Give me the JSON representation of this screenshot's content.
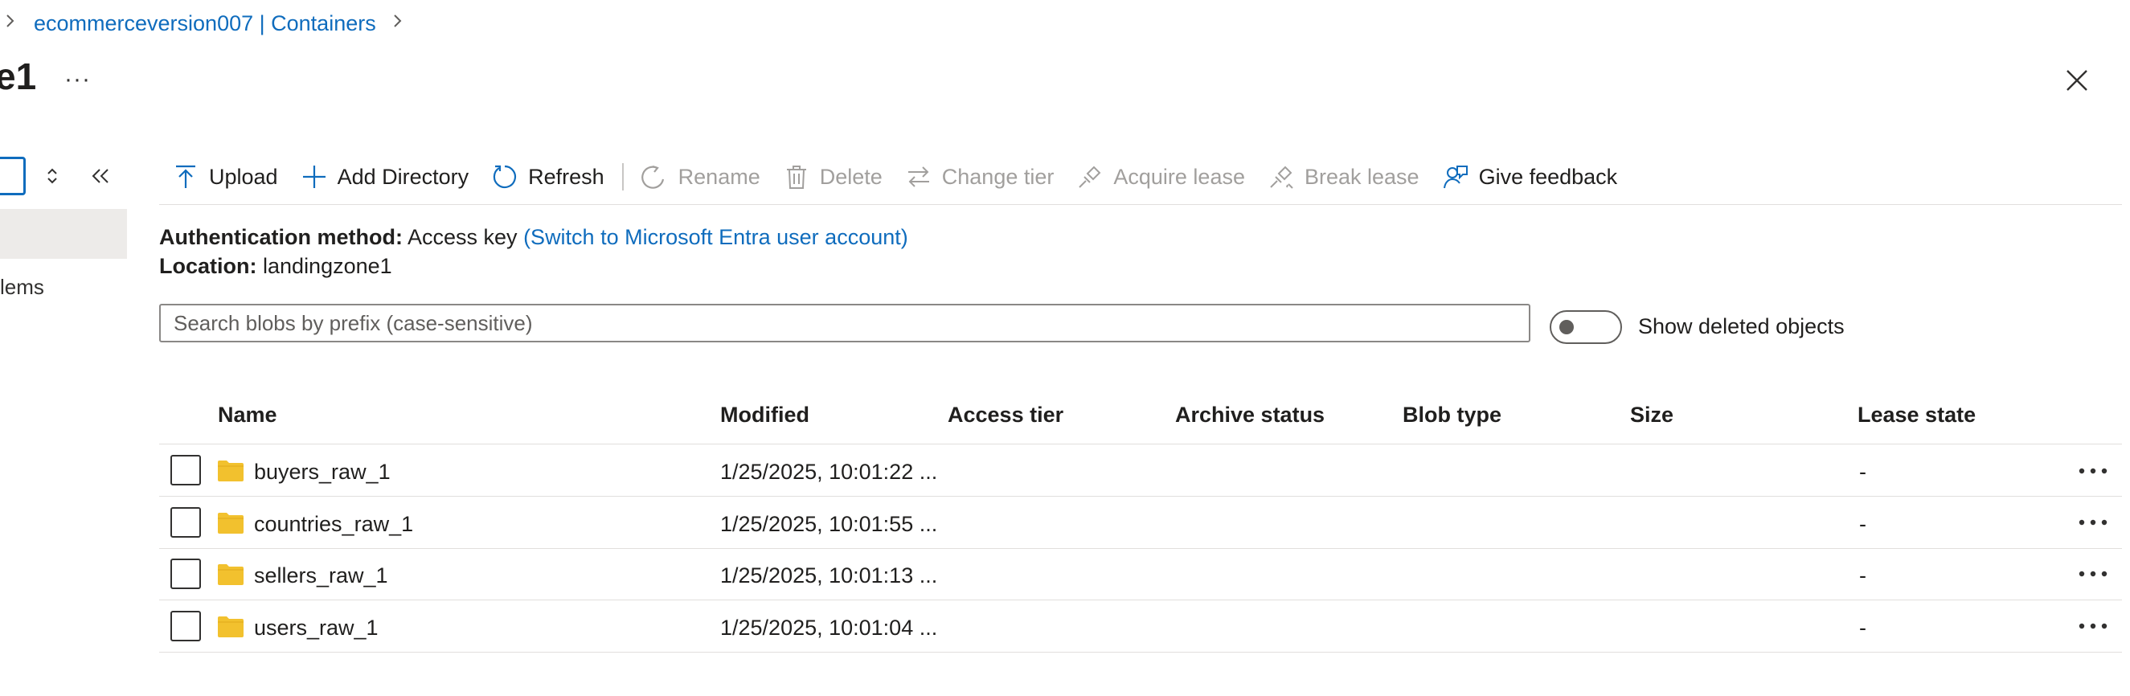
{
  "breadcrumb": {
    "link": "ecommerceversion007 | Containers"
  },
  "page": {
    "title": "e1",
    "more": "···"
  },
  "left_panel": {
    "item": "lems"
  },
  "toolbar": {
    "buttons": [
      {
        "label": "Upload",
        "icon": "upload-icon",
        "enabled": true
      },
      {
        "label": "Add Directory",
        "icon": "add-icon",
        "enabled": true
      },
      {
        "label": "Refresh",
        "icon": "refresh-icon",
        "enabled": true
      },
      {
        "label": "Rename",
        "icon": "rename-icon",
        "enabled": false
      },
      {
        "label": "Delete",
        "icon": "trash-icon",
        "enabled": false
      },
      {
        "label": "Change tier",
        "icon": "swap-icon",
        "enabled": false
      },
      {
        "label": "Acquire lease",
        "icon": "link-icon",
        "enabled": false
      },
      {
        "label": "Break lease",
        "icon": "broken-link-icon",
        "enabled": false
      },
      {
        "label": "Give feedback",
        "icon": "feedback-icon",
        "enabled": true
      }
    ]
  },
  "info": {
    "auth_label": "Authentication method:",
    "auth_value": "Access key",
    "auth_link": "(Switch to Microsoft Entra user account)",
    "location_label": "Location:",
    "location_value": "landingzone1"
  },
  "search": {
    "placeholder": "Search blobs by prefix (case-sensitive)",
    "value": ""
  },
  "toggle": {
    "label": "Show deleted objects",
    "on": false
  },
  "table": {
    "columns": [
      "Name",
      "Modified",
      "Access tier",
      "Archive status",
      "Blob type",
      "Size",
      "Lease state"
    ],
    "rows": [
      {
        "name": "buyers_raw_1",
        "modified": "1/25/2025, 10:01:22 ...",
        "access_tier": "",
        "archive_status": "",
        "blob_type": "",
        "size": "",
        "lease_state": "-"
      },
      {
        "name": "countries_raw_1",
        "modified": "1/25/2025, 10:01:55 ...",
        "access_tier": "",
        "archive_status": "",
        "blob_type": "",
        "size": "",
        "lease_state": "-"
      },
      {
        "name": "sellers_raw_1",
        "modified": "1/25/2025, 10:01:13 ...",
        "access_tier": "",
        "archive_status": "",
        "blob_type": "",
        "size": "",
        "lease_state": "-"
      },
      {
        "name": "users_raw_1",
        "modified": "1/25/2025, 10:01:04 ...",
        "access_tier": "",
        "archive_status": "",
        "blob_type": "",
        "size": "",
        "lease_state": "-"
      }
    ]
  },
  "colors": {
    "accent": "#0f6cbd",
    "folder": "#f2c12e",
    "disabled": "#a19f9d"
  }
}
